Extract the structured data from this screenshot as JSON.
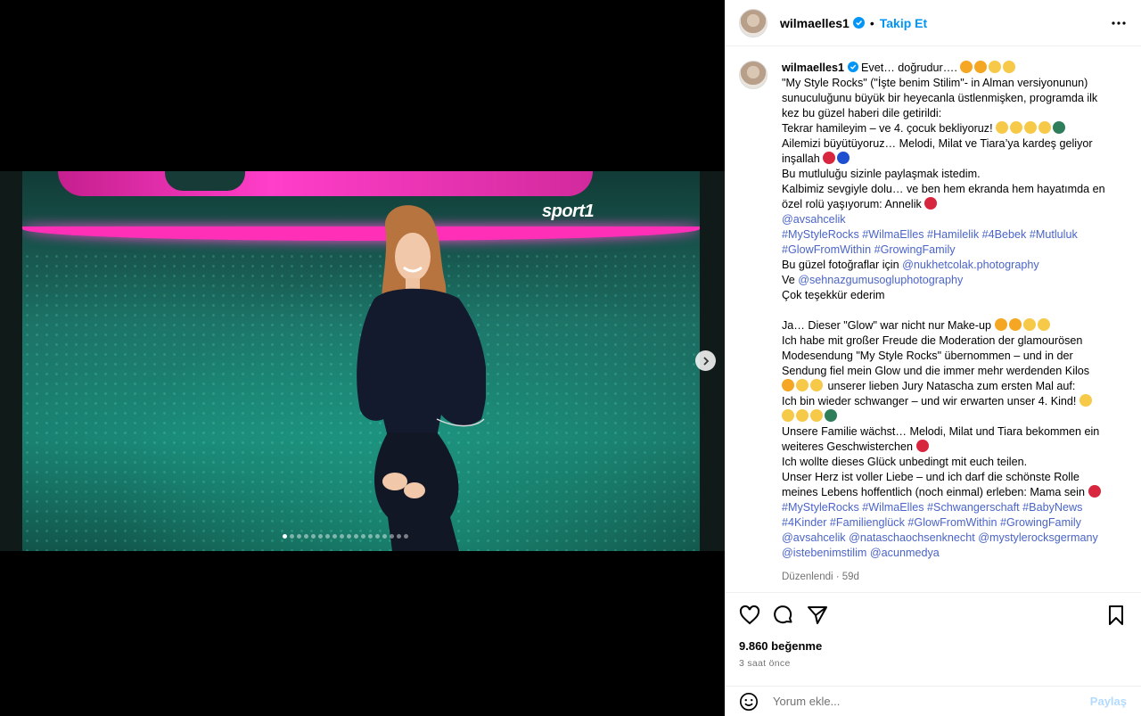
{
  "media": {
    "watermark": "sport1",
    "slide_count": 18,
    "active_slide": 1
  },
  "header": {
    "username": "wilmaelles1",
    "separator": "•",
    "follow_label": "Takip Et"
  },
  "caption": {
    "username": "wilmaelles1",
    "lines": [
      {
        "text": "Evet… doğrudur….",
        "emoji": [
          "#f5a623",
          "#f5a623",
          "#f7c948",
          "#f7c948"
        ]
      },
      {
        "text": "\"My Style Rocks\" (\"İşte benim Stilim\"- in Alman versiyonunun)"
      },
      {
        "text": "sunuculuğunu büyük bir heyecanla üstlenmişken, programda ilk"
      },
      {
        "text": "kez bu güzel haberi dile getirildi:"
      },
      {
        "text": "Tekrar hamileyim – ve 4. çocuk bekliyoruz!",
        "emoji": [
          "#f7c948",
          "#f7c948",
          "#f7c948",
          "#f7c948",
          "#2e7d5b"
        ]
      },
      {
        "text": "Ailemizi büyütüyoruz… Melodi, Milat ve Tiara’ya kardeş geliyor"
      },
      {
        "text": "inşallah",
        "emoji": [
          "#d7263d",
          "#1f4fd1"
        ]
      },
      {
        "text": "Bu mutluluğu sizinle paylaşmak istedim."
      },
      {
        "text": "Kalbimiz sevgiyle dolu… ve ben hem ekranda hem hayatımda en"
      },
      {
        "text": "özel rolü yaşıyorum: Annelik",
        "emoji": [
          "#d7263d"
        ]
      },
      {
        "link": "@avsahcelik"
      },
      {
        "link": "#MyStyleRocks #WilmaElles #Hamilelik #4Bebek #Mutluluk"
      },
      {
        "link": "#GlowFromWithin #GrowingFamily"
      },
      {
        "text": "Bu güzel fotoğraflar için ",
        "link_after": "@nukhetcolak.photography"
      },
      {
        "text": "Ve ",
        "link_after": "@sehnazgumusogluphotography"
      },
      {
        "text": "Çok teşekkür ederim"
      },
      {
        "text": ""
      },
      {
        "text": "Ja… Dieser \"Glow\" war nicht nur Make-up",
        "emoji": [
          "#f5a623",
          "#f5a623",
          "#f7c948",
          "#f7c948"
        ]
      },
      {
        "text": "Ich habe mit großer Freude die Moderation der glamourösen"
      },
      {
        "text": "Modesendung \"My Style Rocks\" übernommen – und in der"
      },
      {
        "text": "Sendung fiel mein Glow und die immer mehr werdenden Kilos"
      },
      {
        "emoji_before": [
          "#f5a623",
          "#f7c948",
          "#f7c948"
        ],
        "text": " unserer lieben Jury Natascha zum ersten Mal auf:"
      },
      {
        "text": "Ich bin wieder schwanger – und wir erwarten unser 4. Kind!",
        "emoji": [
          "#f7c948"
        ]
      },
      {
        "emoji_before": [
          "#f7c948",
          "#f7c948",
          "#f7c948",
          "#2e7d5b"
        ],
        "text": ""
      },
      {
        "text": "Unsere Familie wächst… Melodi, Milat und Tiara bekommen ein"
      },
      {
        "text": "weiteres Geschwisterchen",
        "emoji": [
          "#d7263d"
        ]
      },
      {
        "text": "Ich wollte dieses Glück unbedingt mit euch teilen."
      },
      {
        "text": "Unser Herz ist voller Liebe – und ich darf die schönste Rolle"
      },
      {
        "text": "meines Lebens hoffentlich (noch einmal) erleben: Mama sein",
        "emoji": [
          "#d7263d"
        ]
      },
      {
        "link": "#MyStyleRocks #WilmaElles #Schwangerschaft #BabyNews"
      },
      {
        "link": "#4Kinder #Familienglück #GlowFromWithin #GrowingFamily"
      },
      {
        "link": "@avsahcelik @nataschaochsenknecht @mystylerocksgermany"
      },
      {
        "link": "@istebenimstilim @acunmedya"
      }
    ],
    "edited_label": "Düzenlendi · 59d"
  },
  "stats": {
    "likes": "9.860 beğenme",
    "time_ago": "3 saat önce"
  },
  "comment": {
    "placeholder": "Yorum ekle...",
    "post_label": "Paylaş"
  }
}
